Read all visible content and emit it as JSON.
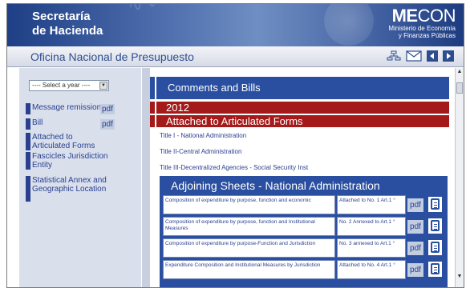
{
  "banner": {
    "secretaria_line1": "Secretaría",
    "secretaria_line2": "de Hacienda",
    "mecon_logo_bold": "ME",
    "mecon_logo_light": "CON",
    "mecon_sub1": "Ministerio de Economía",
    "mecon_sub2": "y Finanzas Públicas"
  },
  "office_bar": {
    "title": "Oficina Nacional de Presupuesto",
    "tools": [
      "sitemap-icon",
      "mail-icon",
      "back-icon",
      "forward-icon"
    ]
  },
  "sidebar": {
    "year_select": "---- Select a year ----",
    "items": [
      {
        "label": "Message remission",
        "pdf": "pdf"
      },
      {
        "label": "Bill",
        "pdf": "pdf"
      },
      {
        "label": "Attached to Articulated Forms"
      },
      {
        "label": "Fascicles Jurisdiction Entity"
      },
      {
        "label": "Statistical Annex and Geographic Location"
      }
    ]
  },
  "main": {
    "header": "Comments and Bills",
    "year": "2012",
    "section": "Attached to Articulated Forms",
    "links": [
      "Title I - National Administration",
      "Title II-Central Administration",
      "Title III-Decentralized Agencies - Social Security Inst"
    ],
    "sheet_title": "Adjoining Sheets - National Administration",
    "rows": [
      {
        "desc": "Composition of expenditure by purpose, function and economic",
        "ref": "Attached to No. 1 Art.1 °",
        "pdf": "pdf"
      },
      {
        "desc": "Composition of expenditure by purpose, function and Institutional Measures",
        "ref": "No. 2 Annexed to Art.1 °",
        "pdf": "pdf"
      },
      {
        "desc": "Composition of expenditure by purpose-Function and Jurisdiction",
        "ref": "No. 3 annexed to Art.1 °",
        "pdf": "pdf"
      },
      {
        "desc": "Expenditure Composition and Institutional Measures by Jurisdiction",
        "ref": "Attached to No. 4 Art.1 °",
        "pdf": "pdf"
      }
    ]
  },
  "colors": {
    "brand_blue": "#2a4fa0",
    "red_header": "#a41a1a",
    "sidebar_bg": "#d9e0ec"
  }
}
